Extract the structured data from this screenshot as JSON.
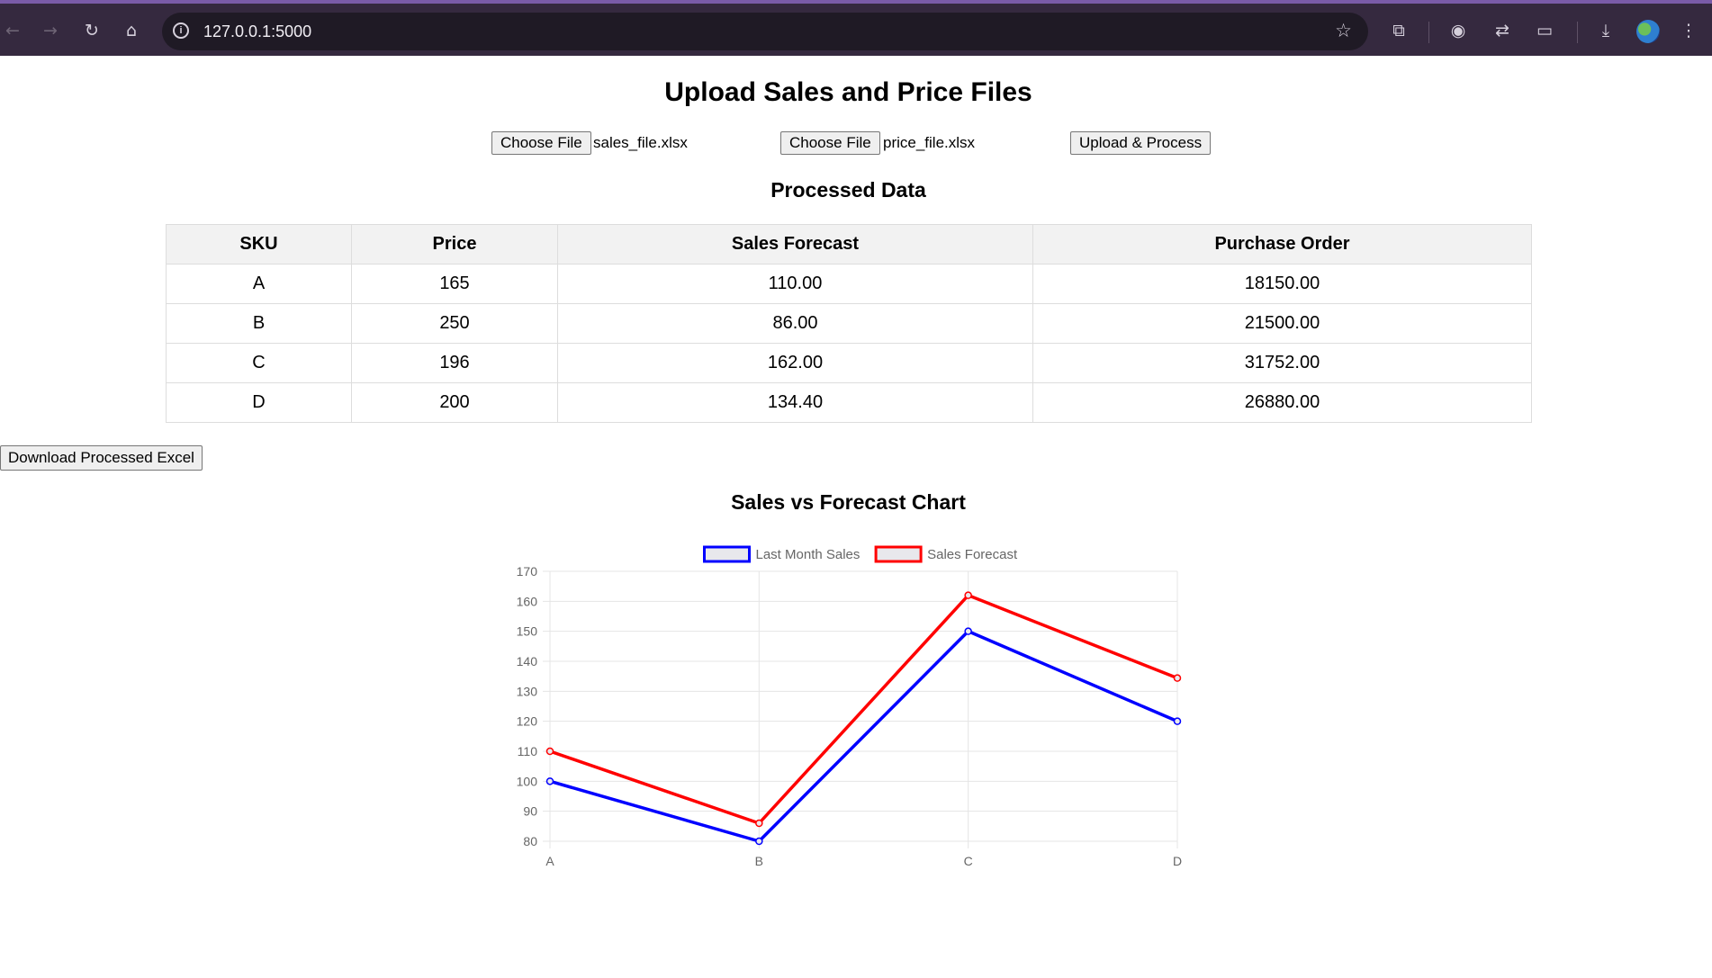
{
  "browser": {
    "url": "127.0.0.1:5000"
  },
  "page": {
    "title": "Upload Sales and Price Files",
    "sales_file": {
      "button": "Choose File",
      "filename": "sales_file.xlsx"
    },
    "price_file": {
      "button": "Choose File",
      "filename": "price_file.xlsx"
    },
    "upload_button": "Upload & Process",
    "processed_title": "Processed Data",
    "download_button": "Download Processed Excel",
    "chart_title": "Sales vs Forecast Chart"
  },
  "table": {
    "headers": [
      "SKU",
      "Price",
      "Sales Forecast",
      "Purchase Order"
    ],
    "rows": [
      [
        "A",
        "165",
        "110.00",
        "18150.00"
      ],
      [
        "B",
        "250",
        "86.00",
        "21500.00"
      ],
      [
        "C",
        "196",
        "162.00",
        "31752.00"
      ],
      [
        "D",
        "200",
        "134.40",
        "26880.00"
      ]
    ]
  },
  "chart_data": {
    "type": "line",
    "categories": [
      "A",
      "B",
      "C",
      "D"
    ],
    "series": [
      {
        "name": "Last Month Sales",
        "values": [
          100,
          80,
          150,
          120
        ],
        "color": "#0000ff"
      },
      {
        "name": "Sales Forecast",
        "values": [
          110,
          86,
          162,
          134.4
        ],
        "color": "#ff0000"
      }
    ],
    "ylim": [
      80,
      170
    ],
    "yticks": [
      80,
      90,
      100,
      110,
      120,
      130,
      140,
      150,
      160,
      170
    ],
    "grid": true,
    "legend": "top-center",
    "legend_fill": "#e8e8ec"
  }
}
